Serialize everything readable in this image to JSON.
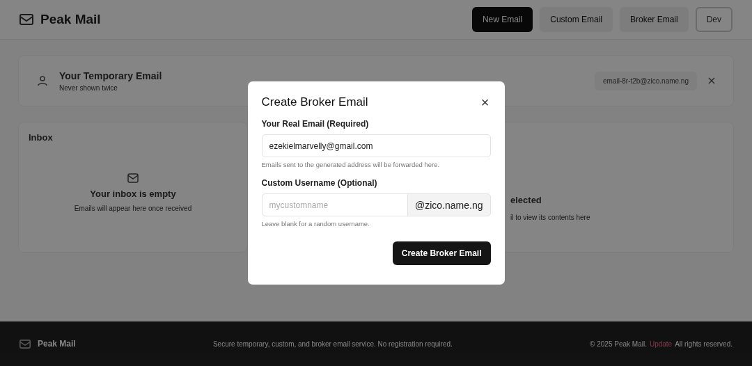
{
  "header": {
    "brand": "Peak Mail",
    "buttons": [
      {
        "label": "New Email",
        "kind": "primary"
      },
      {
        "label": "Custom Email",
        "kind": "ghost"
      },
      {
        "label": "Broker Email",
        "kind": "ghost"
      },
      {
        "label": "Dev",
        "kind": "outline"
      }
    ]
  },
  "temp_email": {
    "title": "Your Temporary Email",
    "subtitle": "Never shown twice",
    "address": "email-8r-t2b@zico.name.ng"
  },
  "inbox": {
    "title": "Inbox",
    "empty_title": "Your inbox is empty",
    "empty_text": "Emails will appear here once received"
  },
  "viewer": {
    "empty_title": "elected",
    "empty_text": "il to view its contents here"
  },
  "footer": {
    "brand": "Peak Mail",
    "tagline": "Secure temporary, custom, and broker email service. No registration required.",
    "copyright": "© 2025 Peak Mail.",
    "link": "Update",
    "rights": "All rights reserved."
  },
  "dialog": {
    "title": "Create Broker Email",
    "close": "×",
    "real_email": {
      "label": "Your Real Email (Required)",
      "value": "ezekielmarvelly@gmail.com",
      "hint": "Emails sent to the generated address will be forwarded here."
    },
    "username": {
      "label": "Custom Username (Optional)",
      "placeholder": "mycustomname",
      "suffix": "@zico.name.ng",
      "hint": "Leave blank for a random username."
    },
    "submit": "Create Broker Email"
  }
}
